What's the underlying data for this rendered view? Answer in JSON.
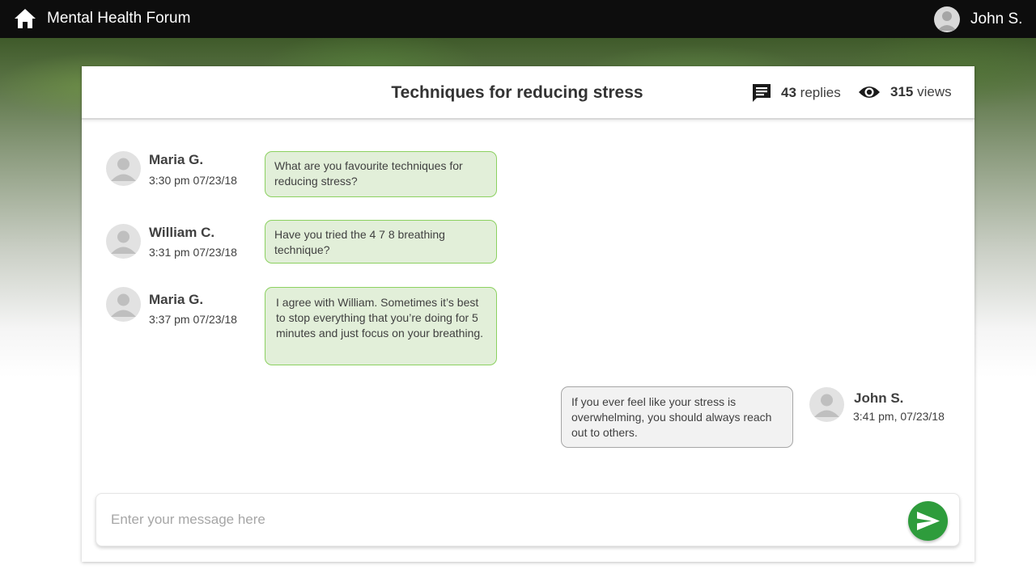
{
  "topbar": {
    "app_title": "Mental Health Forum",
    "user_name": "John S.",
    "icons": {
      "home": "home-icon",
      "avatar": "user-avatar"
    }
  },
  "thread": {
    "title": "Techniques for reducing stress",
    "replies_count": "43",
    "replies_label": "replies",
    "views_count": "315",
    "views_label": "views",
    "icons": {
      "replies": "chat-bubble-icon",
      "views": "eye-icon"
    }
  },
  "messages": [
    {
      "author": "Maria G.",
      "time": "3:30 pm 07/23/18",
      "text": "What are you favourite techniques for reducing stress?",
      "align": "left"
    },
    {
      "author": "William C.",
      "time": "3:31 pm 07/23/18",
      "text": "Have you tried the 4 7 8 breathing technique?",
      "align": "left"
    },
    {
      "author": "Maria G.",
      "time": "3:37 pm 07/23/18",
      "text": "I agree with William. Sometimes  it’s best to stop everything that you’re doing for 5 minutes and just focus on your breathing.",
      "align": "left"
    },
    {
      "author": "John S.",
      "time": "3:41 pm, 07/23/18",
      "text": "If you ever feel like your stress is overwhelming,  you should always reach out to others.",
      "align": "right"
    }
  ],
  "composer": {
    "placeholder": "Enter your message here",
    "value": "",
    "send_icon": "send-icon"
  },
  "colors": {
    "topbar": "#0d0d0d",
    "bubble_others": "#e2efd9",
    "bubble_others_border": "#8cd160",
    "bubble_self": "#f2f2f2",
    "bubble_self_border": "#a6a6a6",
    "send_button": "#2e9c3c"
  }
}
